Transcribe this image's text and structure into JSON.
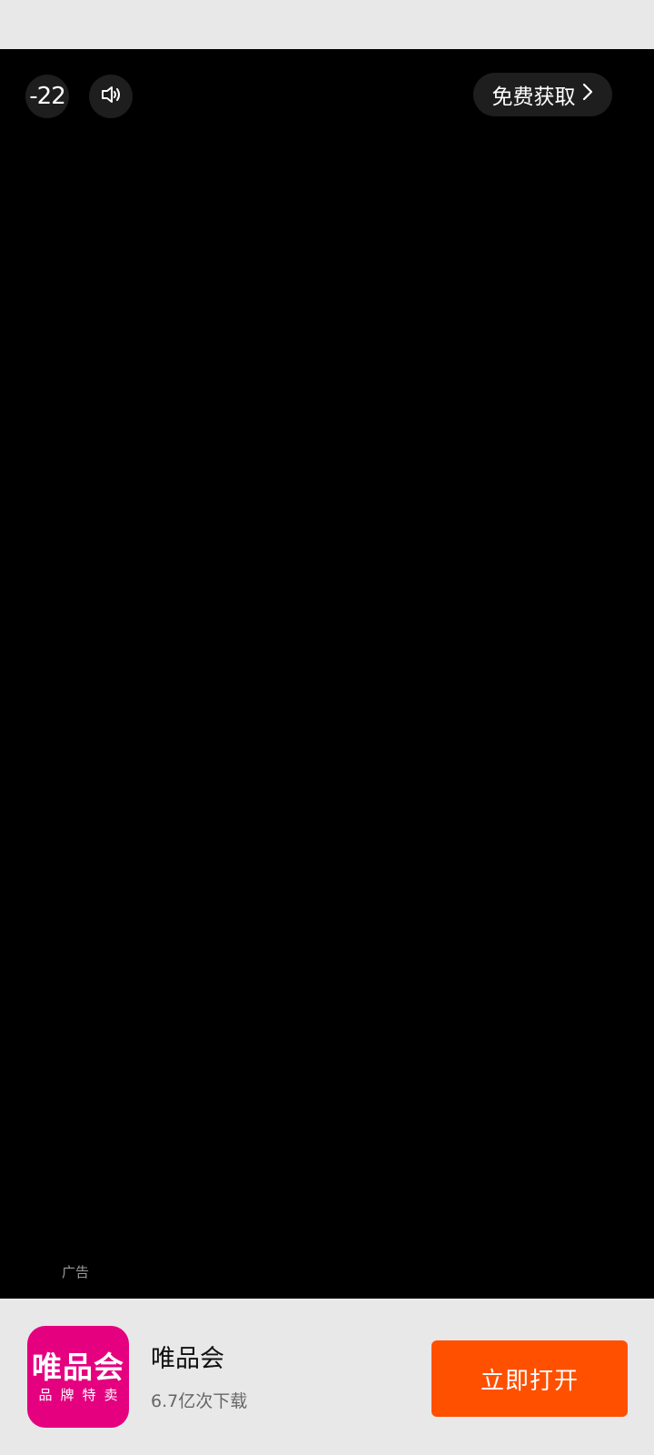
{
  "ad": {
    "countdown": "-22",
    "sound_icon": "speaker-icon",
    "cta_label": "免费获取",
    "cta_icon": "chevron-right-icon",
    "ad_tag": "广告"
  },
  "app": {
    "icon_main": "唯品会",
    "icon_sub": "品牌特卖",
    "name": "唯品会",
    "downloads": "6.7亿次下载",
    "open_button": "立即打开"
  },
  "colors": {
    "brand": "#e4007f",
    "accent": "#ff5000",
    "video_bg": "#000000",
    "panel_bg": "#e8e8e8"
  }
}
